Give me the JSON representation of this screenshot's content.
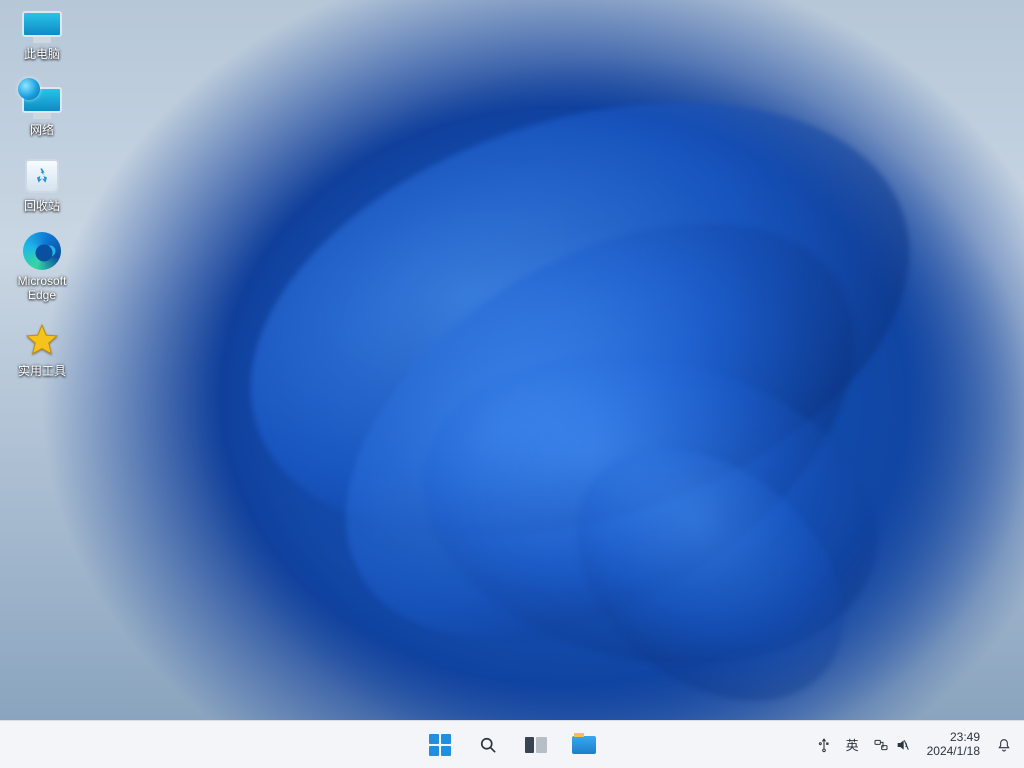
{
  "desktop_icons": [
    {
      "id": "this-pc",
      "label": "此电脑"
    },
    {
      "id": "network",
      "label": "网络"
    },
    {
      "id": "recycle-bin",
      "label": "回收站"
    },
    {
      "id": "microsoft-edge",
      "label": "Microsoft Edge"
    },
    {
      "id": "utilities",
      "label": "实用工具"
    }
  ],
  "taskbar": {
    "pinned": [
      {
        "id": "start",
        "name": "start-button"
      },
      {
        "id": "search",
        "name": "search-button"
      },
      {
        "id": "task-view",
        "name": "task-view-button"
      },
      {
        "id": "file-explorer",
        "name": "file-explorer-button"
      }
    ],
    "tray": {
      "usb": "usb-device-icon",
      "ime_label": "英",
      "network": "network-icon",
      "volume": "volume-icon",
      "clock_time": "23:49",
      "clock_date": "2024/1/18",
      "notifications": "notifications-icon"
    }
  }
}
